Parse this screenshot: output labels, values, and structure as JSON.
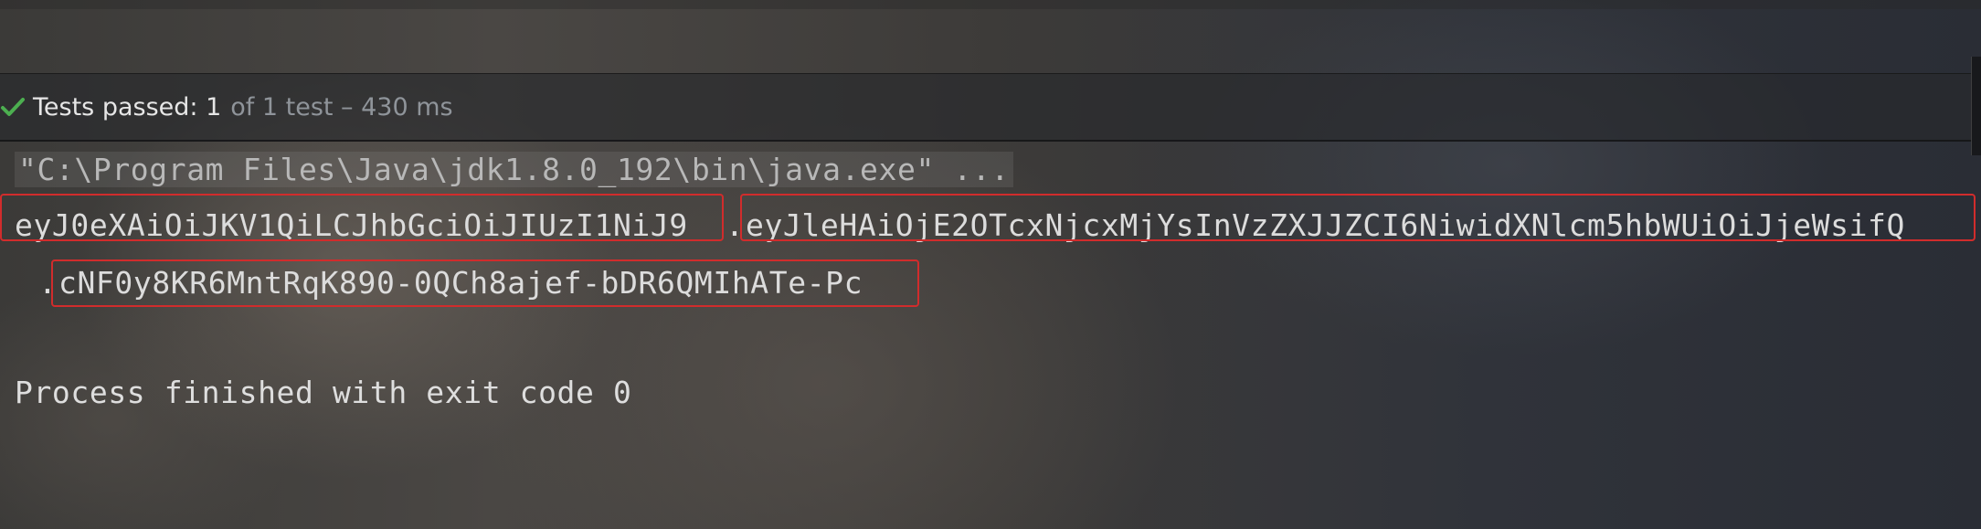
{
  "status": {
    "icon": "check-icon",
    "passed_label": "Tests passed: 1",
    "detail": "of 1 test – 430 ms"
  },
  "console": {
    "command_line": "\"C:\\Program Files\\Java\\jdk1.8.0_192\\bin\\java.exe\" ...",
    "token_header": "eyJ0eXAiOiJKV1QiLCJhbGciOiJIUzI1NiJ9",
    "separator_1": ".",
    "token_payload": "eyJleHAiOjE2OTcxNjcxMjYsInVzZXJJZCI6NiwidXNlcm5hbWUiOiJjeWsifQ",
    "separator_2": ".",
    "token_signature": "cNF0y8KR6MntRqK890-0QCh8ajef-bDR6QMIhATe-Pc",
    "exit_message": "Process finished with exit code 0"
  },
  "colors": {
    "highlight_border": "#d12c2c",
    "success_green": "#4caf50",
    "console_text": "#dcdcdc"
  }
}
